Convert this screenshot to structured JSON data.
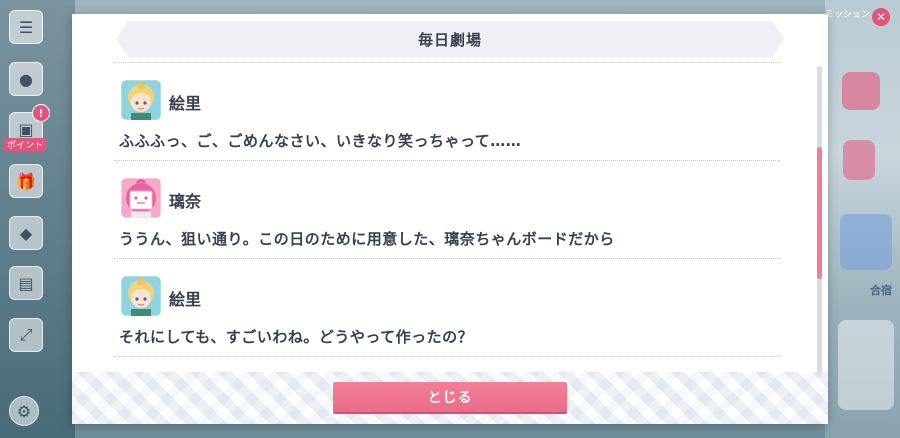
{
  "dialog": {
    "title": "毎日劇場",
    "close_label": "とじる",
    "entries": [
      {
        "speaker": "絵里",
        "line": "ふふふっ、ご、ごめんなさい、いきなり笑っちゃって……",
        "avatar": "eli-avatar"
      },
      {
        "speaker": "璃奈",
        "line": "ううん、狙い通り。この日のために用意した、璃奈ちゃんボードだから",
        "avatar": "rina-avatar"
      },
      {
        "speaker": "絵里",
        "line": "それにしても、すごいわね。どうやって作ったの？",
        "avatar": "eli-avatar"
      }
    ],
    "scroll_progress": 0.45
  },
  "background": {
    "side_label": "ポイント",
    "right_label": "合宿",
    "top_right_text": "ミッション"
  },
  "colors": {
    "accent": "#ef7d97",
    "title_bar": "#eef0f6",
    "text": "#3a3f4d"
  }
}
